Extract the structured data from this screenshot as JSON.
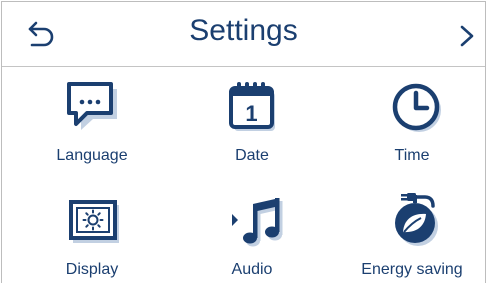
{
  "header": {
    "title": "Settings"
  },
  "tiles": {
    "language": "Language",
    "date": "Date",
    "date_number": "1",
    "time": "Time",
    "display": "Display",
    "audio": "Audio",
    "energy_saving": "Energy saving"
  },
  "colors": {
    "accent": "#1b3f70",
    "icon_shadow": "#c2d0e2",
    "border": "#bdbdbd"
  }
}
